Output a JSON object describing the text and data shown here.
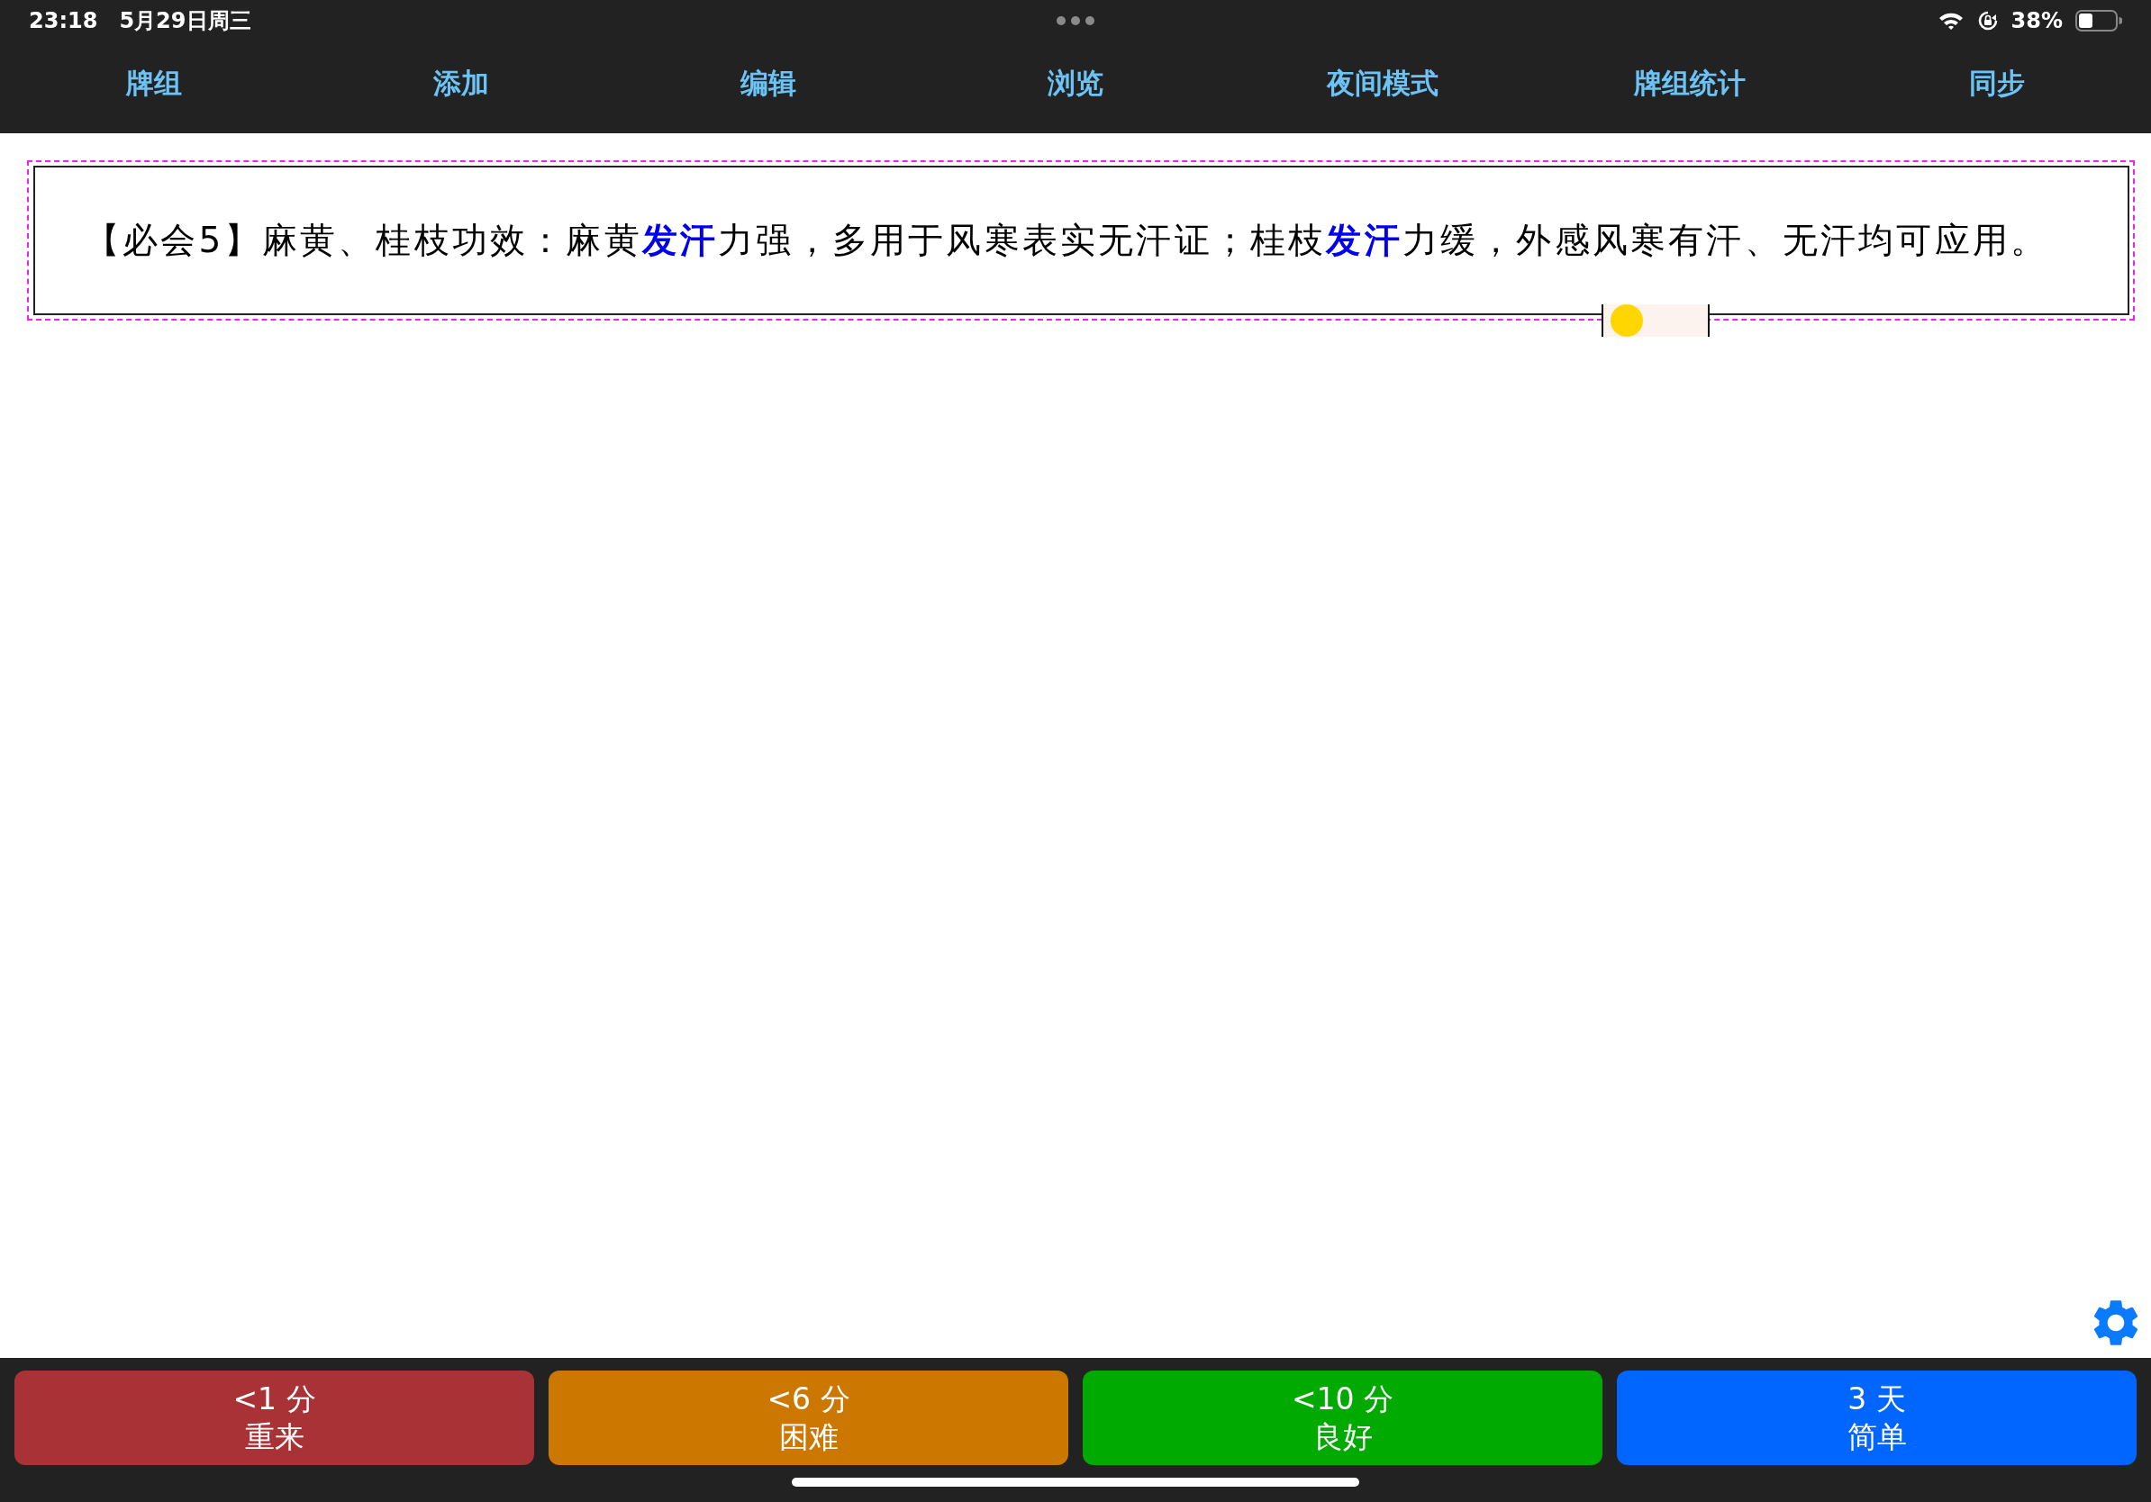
{
  "status_bar": {
    "time": "23:18",
    "date": "5月29日周三",
    "battery": "38%"
  },
  "nav": [
    {
      "label": "牌组"
    },
    {
      "label": "添加"
    },
    {
      "label": "编辑"
    },
    {
      "label": "浏览"
    },
    {
      "label": "夜间模式"
    },
    {
      "label": "牌组统计"
    },
    {
      "label": "同步"
    }
  ],
  "card": {
    "text": "【必会5】麻黄、桂枝功效：麻黄**发汗**力强，多用于风寒表实无汗证；桂枝**发汗**力缓，外感风寒有汗、无汗均可应用。"
  },
  "answer_buttons": [
    {
      "interval": "<1 分",
      "label": "重来",
      "color": "#a83235"
    },
    {
      "interval": "<6 分",
      "label": "困难",
      "color": "#cc7700"
    },
    {
      "interval": "<10 分",
      "label": "良好",
      "color": "#00aa00"
    },
    {
      "interval": "3 天",
      "label": "简单",
      "color": "#0066ff"
    }
  ]
}
